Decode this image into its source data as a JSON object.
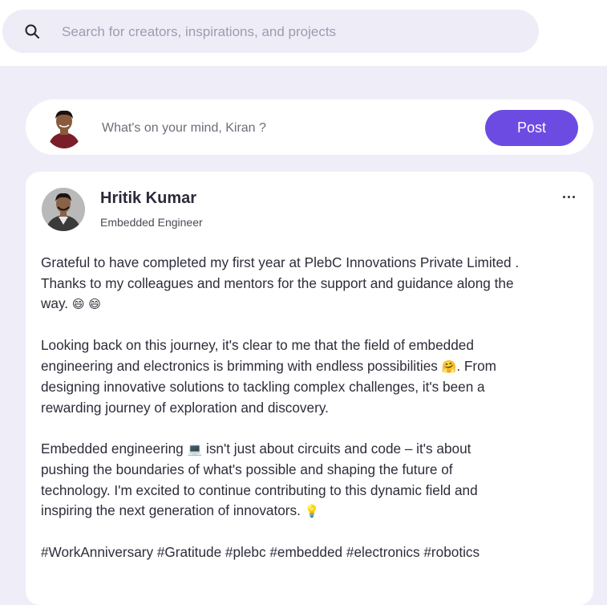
{
  "search": {
    "placeholder": "Search for creators, inspirations, and projects",
    "icon": "search-icon"
  },
  "composer": {
    "placeholder": "What's on your mind, Kiran ?",
    "post_label": "Post",
    "accent_color": "#6c4be3"
  },
  "post": {
    "author_name": "Hritik Kumar",
    "author_role": "Embedded Engineer",
    "paragraphs": [
      {
        "l1": "Grateful to have completed my first year at PlebC Innovations Private Limited .",
        "l2": "Thanks to my colleagues and mentors for the support and guidance along the",
        "l3": "way. ",
        "e1": "😄 😄"
      },
      {
        "l1": "Looking back on this journey, it's clear to me that the field of embedded",
        "l2": "engineering and electronics is brimming with endless possibilities ",
        "e1": "🤗",
        "l2b": ". From",
        "l3": "designing innovative solutions to tackling complex challenges, it's been a",
        "l4": "rewarding journey of exploration and discovery."
      },
      {
        "l1": "Embedded engineering ",
        "e1": "💻",
        "l1b": " isn't just about circuits and code – it's about",
        "l2": "pushing the boundaries of what's possible and shaping the future of",
        "l3": "technology. I'm excited to continue contributing to this dynamic field and",
        "l4": "inspiring the next generation of innovators. ",
        "e2": "💡"
      },
      {
        "l1": "#WorkAnniversary #Gratitude #plebc #embedded #electronics #robotics"
      }
    ]
  }
}
